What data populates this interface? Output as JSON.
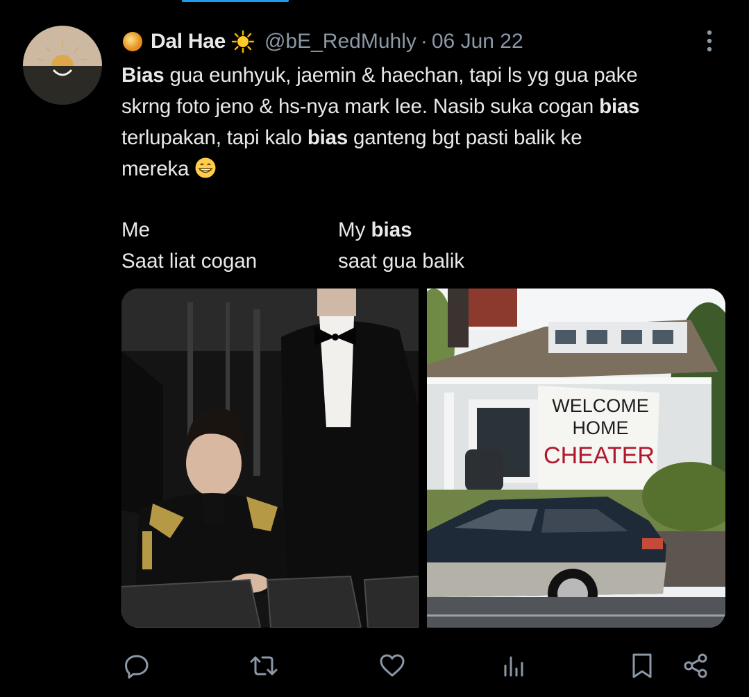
{
  "tweet": {
    "display_name": "Dal Hae",
    "handle": "@bE_RedMuhly",
    "separator": "·",
    "date": "06 Jun 22",
    "text_lines": {
      "l1_bold": "Bias",
      "l1_rest": " gua eunhyuk, jaemin & haechan, tapi ls yg gua pake",
      "l2_rest": "skrng foto jeno & hs-nya mark lee. Nasib suka cogan ",
      "l2_bold": "bias",
      "l3_start": "terlupakan, tapi kalo ",
      "l3_bold": "bias",
      "l3_rest": " ganteng bgt pasti balik ke",
      "l4": "mereka"
    },
    "caption_left": {
      "line1": "Me",
      "line2": "Saat liat cogan"
    },
    "caption_right": {
      "line1_start": "My ",
      "line1_bold": "bias",
      "line2": "saat gua balik"
    },
    "banner_text": {
      "line1": "WELCOME",
      "line2": "HOME",
      "line3": "CHEATER"
    }
  },
  "icons": {
    "name_prefix": "sun-orb-icon",
    "name_suffix": "sun-emoji-icon",
    "emoji": "grinning-face-icon",
    "more": "more-vertical-icon",
    "actions": [
      "reply-icon",
      "retweet-icon",
      "like-icon",
      "views-icon",
      "bookmark-icon",
      "share-icon"
    ]
  },
  "colors": {
    "background": "#000000",
    "text": "#e7e9ea",
    "secondary": "#8b98a5",
    "accent": "#1d9bf0"
  }
}
